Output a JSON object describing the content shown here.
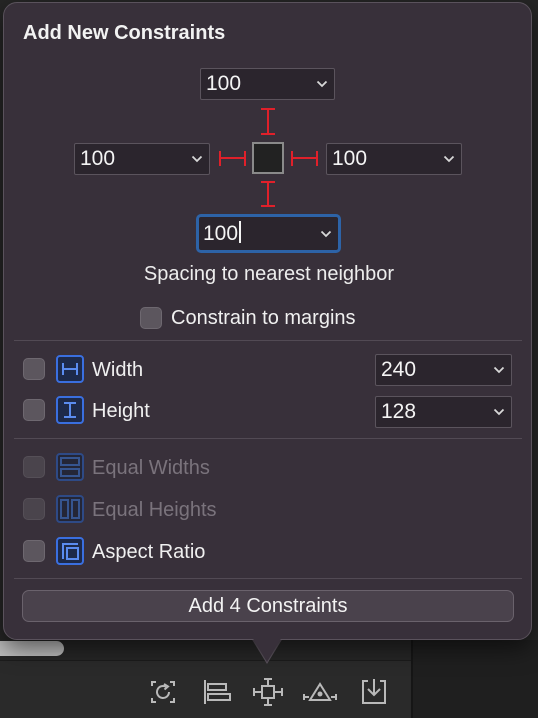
{
  "popover": {
    "title": "Add New Constraints",
    "spacing": {
      "top": "100",
      "left": "100",
      "right": "100",
      "bottom": "100"
    },
    "spacing_caption": "Spacing to nearest neighbor",
    "constrain_margins_label": "Constrain to margins",
    "constraints": [
      {
        "label": "Width",
        "value": "240",
        "checked": false,
        "enabled": true,
        "icon": "width-icon"
      },
      {
        "label": "Height",
        "value": "128",
        "checked": false,
        "enabled": true,
        "icon": "height-icon"
      },
      {
        "label": "Equal Widths",
        "checked": false,
        "enabled": false,
        "icon": "equal-widths-icon"
      },
      {
        "label": "Equal Heights",
        "checked": false,
        "enabled": false,
        "icon": "equal-heights-icon"
      },
      {
        "label": "Aspect Ratio",
        "checked": false,
        "enabled": true,
        "icon": "aspect-ratio-icon"
      }
    ],
    "add_button_label": "Add 4 Constraints"
  },
  "toolbar": {
    "icons": [
      "update-frames-icon",
      "align-icon",
      "add-constraints-icon",
      "resolve-issues-icon",
      "embed-in-icon"
    ]
  },
  "colors": {
    "popover_bg": "#38303a",
    "constraint_red": "#e0202a",
    "accent_blue": "#2d63a7",
    "icon_blue": "#3a6fe0"
  }
}
